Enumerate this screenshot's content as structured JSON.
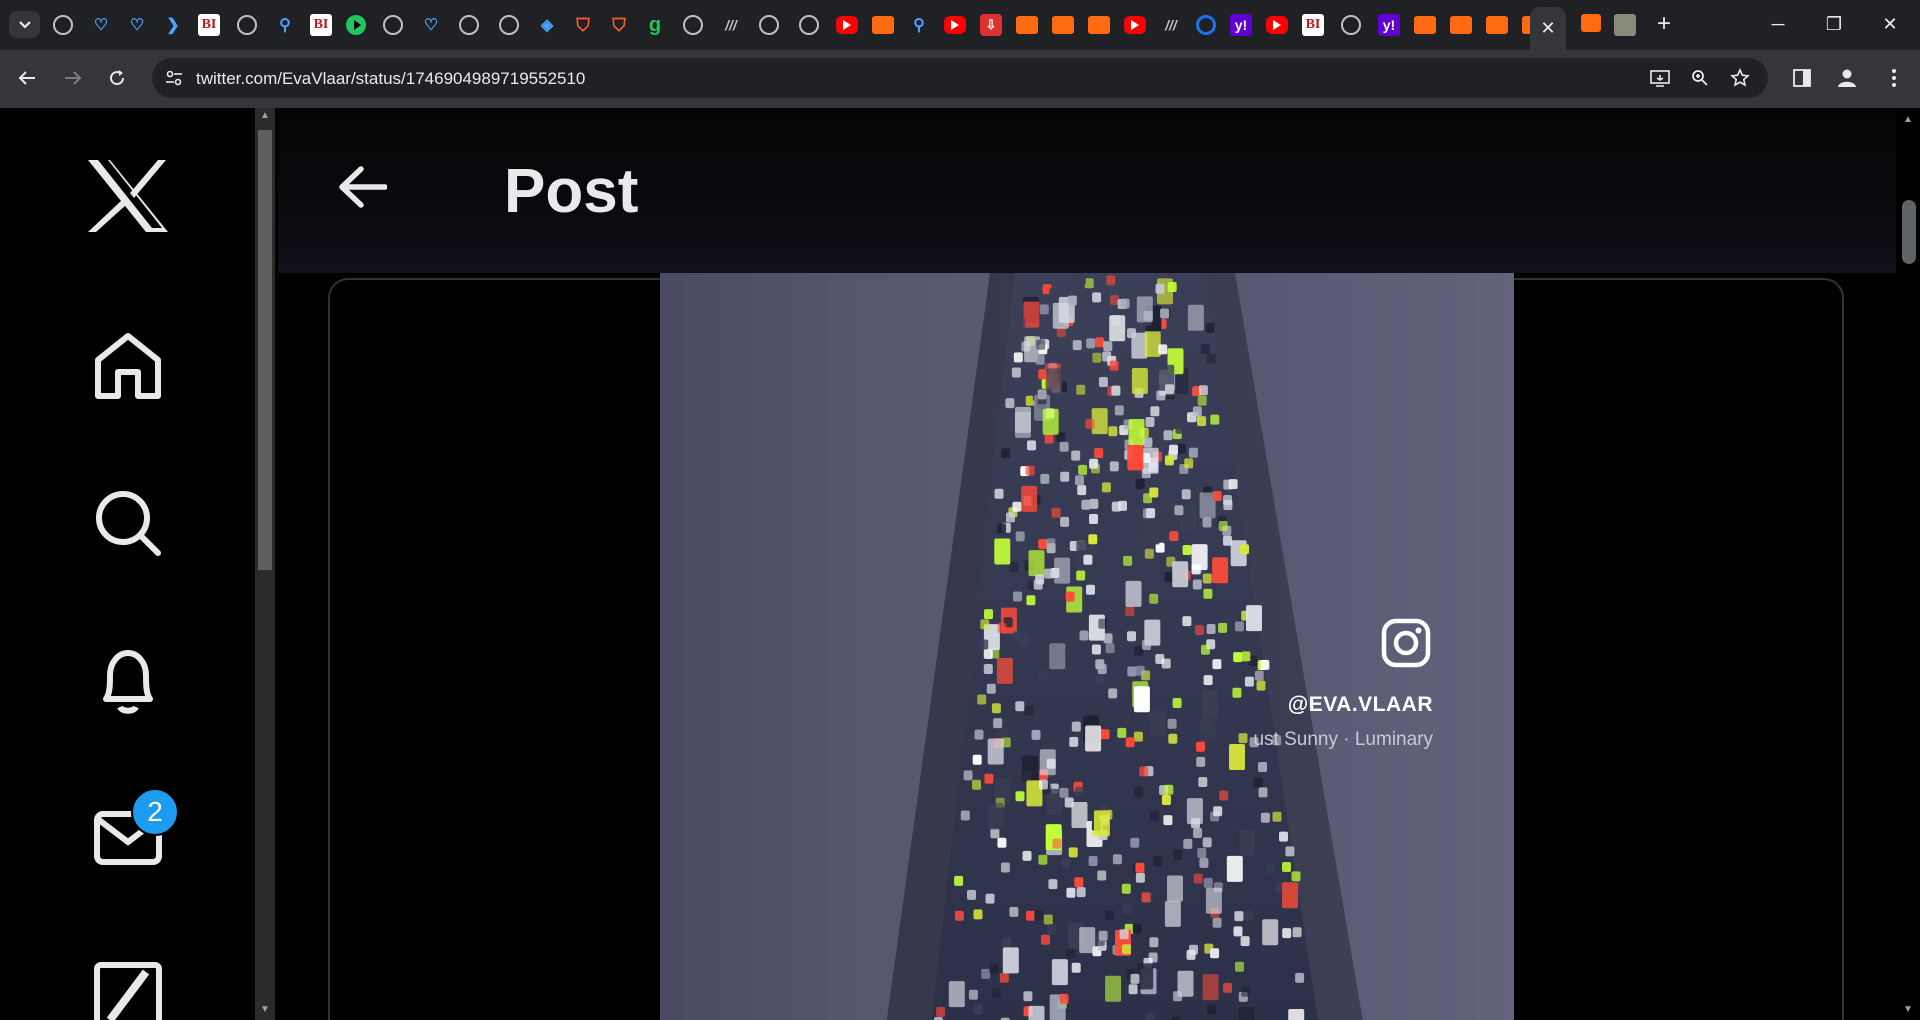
{
  "browser": {
    "active_tab_close": "✕",
    "new_tab": "+",
    "url": "twitter.com/EvaVlaar/status/1746904989719552510",
    "window_controls": {
      "minimize": "─",
      "restore": "❐",
      "close": "✕"
    },
    "tab_favicons": [
      "globe",
      "heart-shield",
      "heart-shield",
      "arrow-blue",
      "business-insider",
      "globe",
      "magnifier",
      "business-insider",
      "play-green",
      "globe",
      "heart-shield",
      "globe",
      "globe",
      "cube",
      "shield-orange",
      "shield-orange",
      "grammarly",
      "globe",
      "slashes",
      "globe",
      "globe",
      "youtube",
      "bookmark",
      "magnifier",
      "youtube",
      "reader",
      "bookmark",
      "bookmark",
      "bookmark",
      "youtube",
      "slashes",
      "circle",
      "yahoo",
      "youtube",
      "business-insider",
      "globe",
      "yahoo",
      "bookmark",
      "bookmark",
      "bookmark",
      "bookmark"
    ],
    "tab_bi_label": "BI",
    "tab_yahoo_label": "y!"
  },
  "twitter": {
    "header_title": "Post",
    "messages_badge": "2",
    "media": {
      "ig_handle": "@EVA.VLAAR",
      "music_credit": "ust Sunny · Luminary"
    }
  },
  "colors": {
    "accent": "#1d9bf0",
    "background": "#000000",
    "text": "#e7e9ea"
  }
}
